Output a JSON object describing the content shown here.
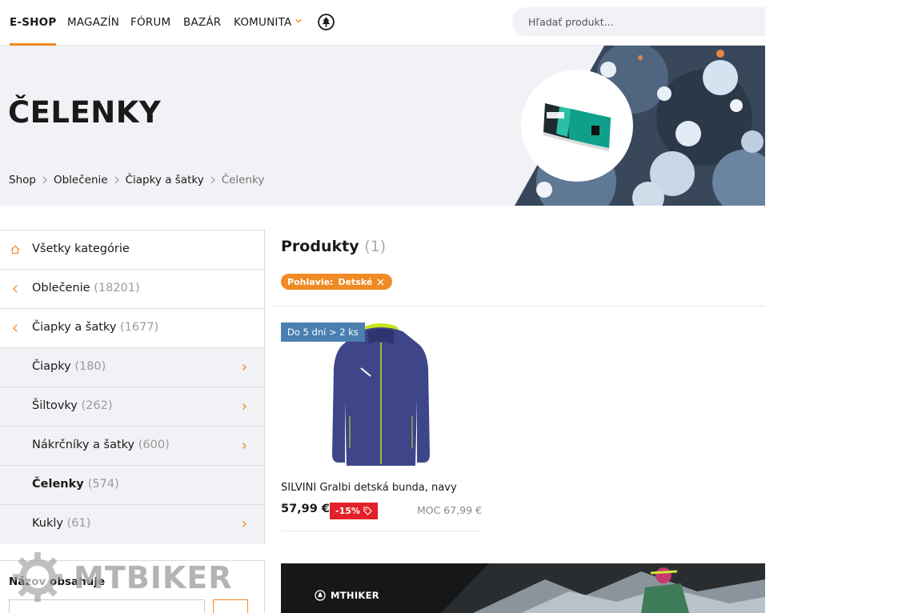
{
  "nav": {
    "items": [
      "E-SHOP",
      "MAGAZÍN",
      "FÓRUM",
      "BAZÁR",
      "KOMUNITA"
    ],
    "search_placeholder": "Hľadať produkt..."
  },
  "hero": {
    "title": "ČELENKY",
    "breadcrumb": [
      "Shop",
      "Oblečenie",
      "Čiapky a šatky",
      "Čelenky"
    ]
  },
  "sidebar": {
    "categories": [
      {
        "label": "Všetky kategórie",
        "count": ""
      },
      {
        "label": "Oblečenie",
        "count": "(18201)"
      },
      {
        "label": "Čiapky a šatky",
        "count": "(1677)"
      },
      {
        "label": "Čiapky",
        "count": "(180)"
      },
      {
        "label": "Šiltovky",
        "count": "(262)"
      },
      {
        "label": "Nákrčníky a šatky",
        "count": "(600)"
      },
      {
        "label": "Čelenky",
        "count": "(574)"
      },
      {
        "label": "Kukly",
        "count": "(61)"
      }
    ],
    "filter_label": "Názov obsahuje"
  },
  "main": {
    "title": "Produkty",
    "count": "(1)",
    "filter_chip": {
      "key": "Pohlavie:",
      "value": "Detské"
    }
  },
  "product": {
    "badge": "Do 5 dní > 2 ks",
    "name": "SILVINI Gralbi detská bunda, navy",
    "price": "57,99 €",
    "discount": "-15%",
    "moc": "MOC 67,99 €"
  },
  "banner": {
    "brand": "MTHIKER"
  },
  "watermark": {
    "text": "MTBIKER"
  },
  "colors": {
    "accent": "#f08a24",
    "badge_blue": "#4a7fb0",
    "discount_red": "#e3202a",
    "hero_bg": "#f1f2f5"
  }
}
